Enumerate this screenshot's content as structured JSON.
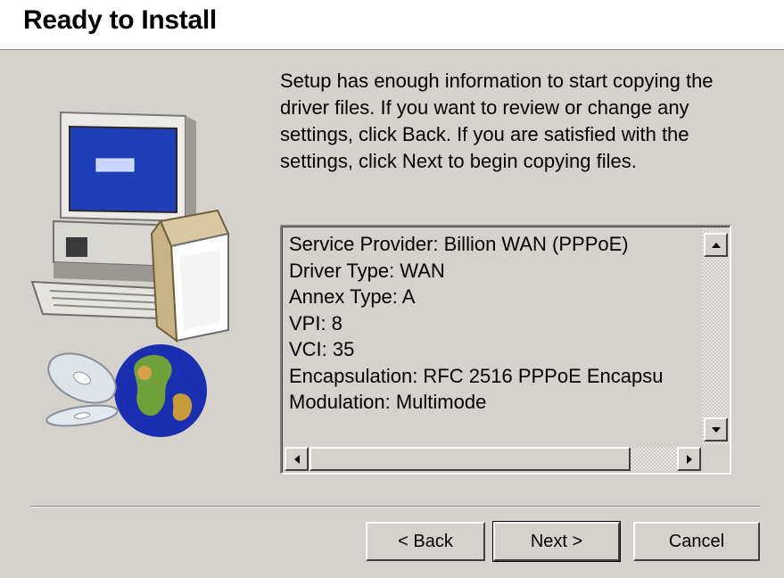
{
  "header": {
    "title": "Ready to Install"
  },
  "intro_text": "Setup has enough information to start copying the driver files.  If you want to review or change any settings, click Back.  If you are satisfied with the settings, click Next to begin copying files.",
  "summary": {
    "lines": [
      "Service Provider: Billion WAN (PPPoE)",
      "Driver Type: WAN",
      "Annex Type: A",
      "VPI: 8",
      "VCI: 35",
      "Encapsulation: RFC 2516 PPPoE Encapsu",
      "Modulation: Multimode"
    ]
  },
  "buttons": {
    "back": "< Back",
    "next": "Next >",
    "cancel": "Cancel"
  },
  "icons": {
    "illustration": "computer-box-globe-cd-illustration",
    "scroll_up": "scroll-up-arrow-icon",
    "scroll_down": "scroll-down-arrow-icon",
    "scroll_left": "scroll-left-arrow-icon",
    "scroll_right": "scroll-right-arrow-icon"
  },
  "colors": {
    "panel_bg": "#d5d1cc",
    "header_bg": "#ffffff",
    "monitor_screen": "#1f3fb8"
  }
}
